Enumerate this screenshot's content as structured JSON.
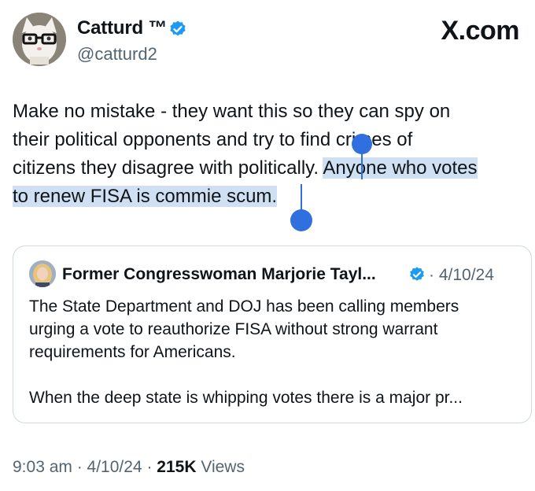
{
  "author": {
    "display_name": "Catturd ™",
    "handle": "@catturd2"
  },
  "brand": "X.com",
  "tweet": {
    "lines": [
      "Make no mistake - they want this so they can spy on",
      "their political opponents and try to find crimes of",
      "citizens they disagree with politically. ",
      "to renew FISA is commie scum."
    ],
    "selected_part_line3": "Anyone who votes"
  },
  "quoted": {
    "name": "Former Congresswoman Marjorie Tayl...",
    "date": "· 4/10/24",
    "lines": [
      "The State Department and DOJ has been calling members",
      "urging a vote to reauthorize FISA without strong warrant",
      "requirements for Americans."
    ],
    "line_after_gap": "When the deep state is whipping votes there is a major pr..."
  },
  "meta": {
    "time": "9:03 am · 4/10/24 · ",
    "views_count": "215K",
    "views_label": " Views"
  },
  "colors": {
    "selection": "#cfe0f3",
    "handle": "#2f6fde",
    "verified": "#1d9bf0"
  }
}
